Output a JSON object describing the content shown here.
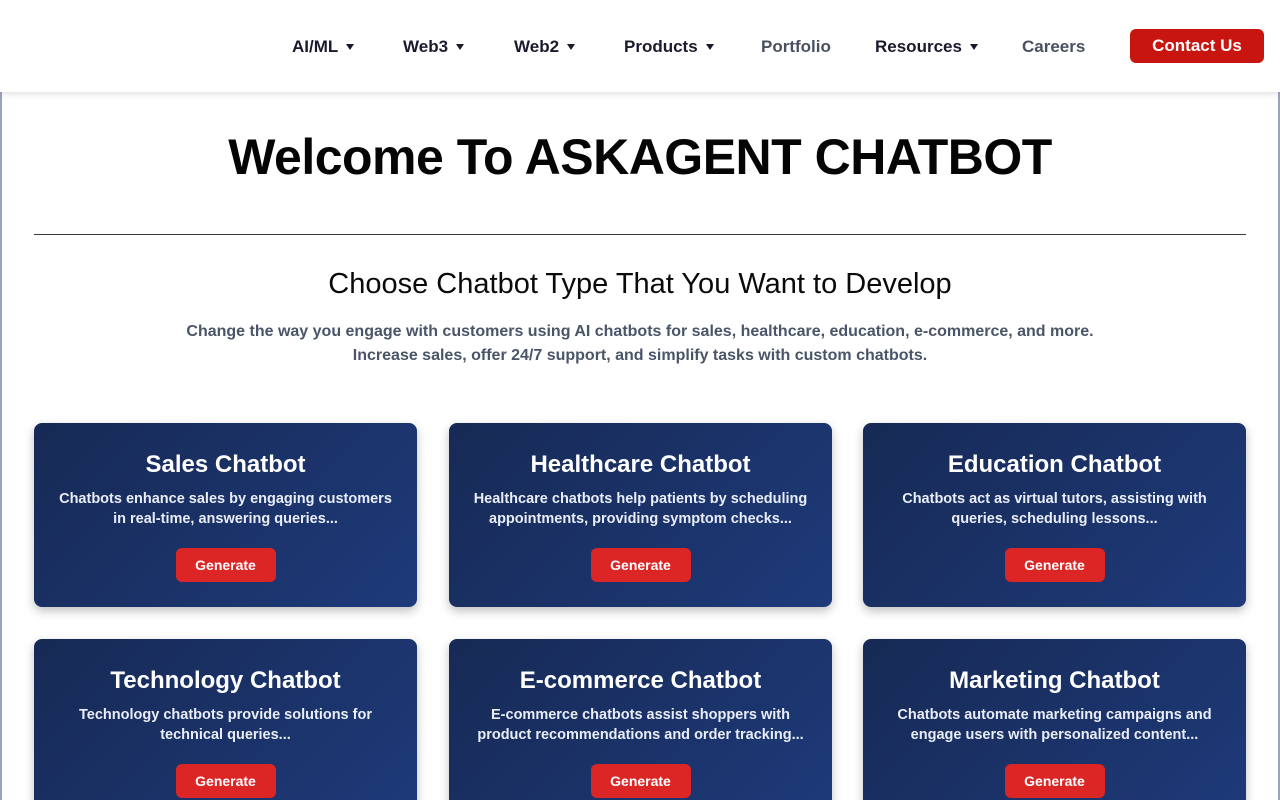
{
  "nav": {
    "items": [
      {
        "label": "AI/ML",
        "has_dropdown": true
      },
      {
        "label": "Web3",
        "has_dropdown": true
      },
      {
        "label": "Web2",
        "has_dropdown": true
      },
      {
        "label": "Products",
        "has_dropdown": true
      },
      {
        "label": "Portfolio",
        "has_dropdown": false
      },
      {
        "label": "Resources",
        "has_dropdown": true
      },
      {
        "label": "Careers",
        "has_dropdown": false
      }
    ],
    "contact_label": "Contact Us"
  },
  "hero": {
    "title": "Welcome To ASKAGENT CHATBOT",
    "subtitle": "Choose Chatbot Type That You Want to Develop",
    "description_line1": "Change the way you engage with customers using AI chatbots for sales, healthcare, education, e-commerce, and more.",
    "description_line2": "Increase sales, offer 24/7 support, and simplify tasks with custom chatbots."
  },
  "cards": [
    {
      "title": "Sales Chatbot",
      "line1": "Chatbots enhance sales by engaging customers",
      "line2": "in real-time, answering queries...",
      "button": "Generate"
    },
    {
      "title": "Healthcare Chatbot",
      "line1": "Healthcare chatbots help patients by scheduling",
      "line2": "appointments, providing symptom checks...",
      "button": "Generate"
    },
    {
      "title": "Education Chatbot",
      "line1": "Chatbots act as virtual tutors, assisting with",
      "line2": "queries, scheduling lessons...",
      "button": "Generate"
    },
    {
      "title": "Technology Chatbot",
      "line1": "Technology chatbots provide solutions for",
      "line2": "technical queries...",
      "button": "Generate"
    },
    {
      "title": "E-commerce Chatbot",
      "line1": "E-commerce chatbots assist shoppers with",
      "line2": "product recommendations and order tracking...",
      "button": "Generate"
    },
    {
      "title": "Marketing Chatbot",
      "line1": "Chatbots automate marketing campaigns and",
      "line2": "engage users with personalized content...",
      "button": "Generate"
    }
  ],
  "colors": {
    "accent_red": "#dc2626",
    "contact_red": "#c8150f",
    "card_navy": "#172a55"
  }
}
